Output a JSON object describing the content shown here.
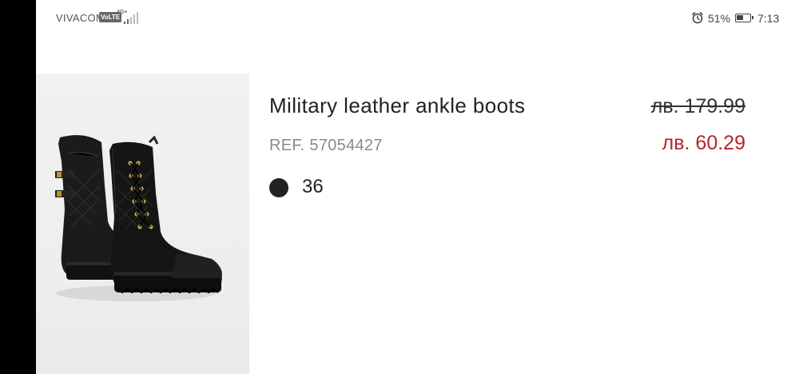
{
  "status_bar": {
    "carrier": "VIVACOM",
    "volte_badge": "VoLTE",
    "network_type": "4G+",
    "battery_percent_label": "51%",
    "battery_level": 0.51,
    "time": "7:13",
    "icons": [
      "alarm-icon",
      "battery-icon",
      "signal-icon"
    ]
  },
  "product": {
    "title": "Military leather ankle boots",
    "ref": "REF. 57054427",
    "price_original": "лв. 179.99",
    "price_sale": "лв. 60.29",
    "color_value": "#222222",
    "size": "36"
  },
  "colors": {
    "sale_price": "#b3262b",
    "text_primary": "#222222",
    "text_secondary": "#8a8a8a"
  }
}
